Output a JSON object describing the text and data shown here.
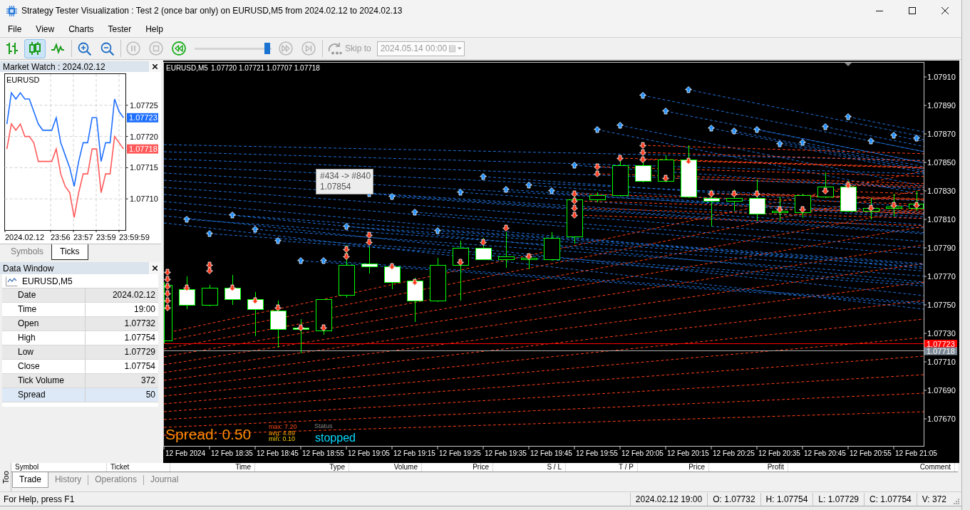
{
  "window": {
    "title": "Strategy Tester Visualization : Test 2 (once bar only) on EURUSD,M5 from 2024.02.12 to 2024.02.13"
  },
  "menu": [
    {
      "label": "File"
    },
    {
      "label": "View"
    },
    {
      "label": "Charts"
    },
    {
      "label": "Tester"
    },
    {
      "label": "Help"
    }
  ],
  "toolbar": {
    "chart_modes": [
      {
        "kind": "bars",
        "selected": false
      },
      {
        "kind": "candles",
        "selected": true
      },
      {
        "kind": "line",
        "selected": false
      }
    ],
    "playback": [
      {
        "kind": "pause",
        "disabled": true
      },
      {
        "kind": "stop",
        "disabled": true
      },
      {
        "kind": "rewind",
        "disabled": false
      }
    ],
    "speed": {
      "level": 0.98
    },
    "stepping": [
      {
        "kind": "fast_forward",
        "disabled": true
      },
      {
        "kind": "step",
        "disabled": true
      }
    ],
    "skip": {
      "label": "Skip to",
      "disabled": true,
      "value": "2024.05.14 00:00"
    }
  },
  "market_watch": {
    "title": "Market Watch : 2024.02.12",
    "symbol": "EURUSD",
    "ask_tag": "1.07723",
    "bid_tag": "1.07718",
    "time_labels": [
      "2024.02.12",
      "23:56",
      "23:57",
      "23:59",
      "23:59:59"
    ],
    "chart_data": {
      "type": "line",
      "categories": [
        null,
        null,
        null,
        null,
        null,
        null,
        null,
        null,
        null,
        null,
        null,
        null,
        null,
        null,
        null,
        null,
        null,
        null,
        null,
        null,
        null,
        null,
        null,
        null,
        null,
        null,
        null
      ],
      "ylim": [
        1.07705,
        1.0773
      ],
      "grid": true,
      "yticks": [
        {
          "value": 1.0771,
          "label": "1.07710"
        },
        {
          "value": 1.07715,
          "label": "1.07715"
        },
        {
          "value": 1.0772,
          "label": "1.07720"
        },
        {
          "value": 1.07725,
          "label": "1.07725"
        }
      ],
      "series": [
        {
          "color": "#1f6fff",
          "values": [
            1.07722,
            1.07727,
            1.07726,
            1.07727,
            1.07726,
            1.07726,
            1.07724,
            1.07722,
            1.07721,
            1.07721,
            1.07721,
            1.07723,
            1.07719,
            1.07717,
            1.07715,
            1.07712,
            1.07716,
            1.07719,
            1.07719,
            1.07723,
            1.07723,
            1.07716,
            1.07719,
            1.07719,
            1.07726,
            1.07724,
            1.07723
          ]
        },
        {
          "color": "#ff5a5a",
          "values": [
            1.07718,
            1.07722,
            1.07721,
            1.07722,
            1.0772,
            1.0772,
            1.07719,
            1.07716,
            1.07716,
            1.07716,
            1.07716,
            1.07718,
            1.07714,
            1.07712,
            1.07711,
            1.07707,
            1.07711,
            1.07714,
            1.07714,
            1.07718,
            1.07718,
            1.07711,
            1.07714,
            1.07714,
            1.0772,
            1.07719,
            1.07718
          ]
        }
      ]
    },
    "tabs": [
      {
        "label": "Symbols",
        "selected": false
      },
      {
        "label": "Ticks",
        "selected": true
      }
    ]
  },
  "data_window": {
    "title": "Data Window",
    "symbol": "EURUSD,M5",
    "rows": [
      {
        "label": "Date",
        "value": "2024.02.12",
        "selected": false
      },
      {
        "label": "Time",
        "value": "19:00",
        "selected": false
      },
      {
        "label": "Open",
        "value": "1.07732",
        "selected": false
      },
      {
        "label": "High",
        "value": "1.07754",
        "selected": false
      },
      {
        "label": "Low",
        "value": "1.07729",
        "selected": false
      },
      {
        "label": "Close",
        "value": "1.07754",
        "selected": false
      },
      {
        "label": "Tick Volume",
        "value": "372",
        "selected": false
      },
      {
        "label": "Spread",
        "value": "50",
        "selected": true
      }
    ]
  },
  "chart": {
    "symbol": "EURUSD,M5",
    "quote": "1.07720 1.07721 1.07707 1.07718",
    "price_axis": [
      "1.07910",
      "1.07890",
      "1.07870",
      "1.07850",
      "1.07830",
      "1.07810",
      "1.07790",
      "1.07770",
      "1.07750",
      "1.07730",
      "1.07710",
      "1.07690",
      "1.07670"
    ],
    "time_axis": [
      "12 Feb 2024",
      "12 Feb 18:35",
      "12 Feb 18:45",
      "12 Feb 18:55",
      "12 Feb 19:05",
      "12 Feb 19:15",
      "12 Feb 19:25",
      "12 Feb 19:35",
      "12 Feb 19:45",
      "12 Feb 19:55",
      "12 Feb 20:05",
      "12 Feb 20:15",
      "12 Feb 20:25",
      "12 Feb 20:35",
      "12 Feb 20:45",
      "12 Feb 20:55",
      "12 Feb 21:05"
    ],
    "ask_tag": "1.07723",
    "bid_tag": "1.07718",
    "tooltip": [
      "#434 -> #840",
      "1.07854"
    ],
    "spread": {
      "value": "Spread: 0.50",
      "stats": [
        {
          "kind": "max",
          "text": "max: 7.20"
        },
        {
          "kind": "avg",
          "text": "avg: 4.89"
        },
        {
          "kind": "min",
          "text": "min: 0.10"
        }
      ]
    },
    "status": {
      "label": "Status",
      "value": "stopped"
    }
  },
  "toolbox": {
    "label": "Too",
    "columns": [
      "Symbol",
      "Ticket",
      "Time",
      "Type",
      "Volume",
      "Price",
      "S / L",
      "T / P",
      "Price",
      "Profit",
      "Comment"
    ],
    "tabs": [
      {
        "label": "Trade",
        "selected": true
      },
      {
        "label": "History",
        "selected": false
      },
      {
        "label": "Operations",
        "selected": false
      },
      {
        "label": "Journal",
        "selected": false
      }
    ]
  },
  "status_bar": {
    "help": "For Help, press F1",
    "cells": [
      "2024.02.12 19:00",
      "O: 1.07732",
      "H: 1.07754",
      "L: 1.07729",
      "C: 1.07754",
      "V: 372"
    ]
  }
}
